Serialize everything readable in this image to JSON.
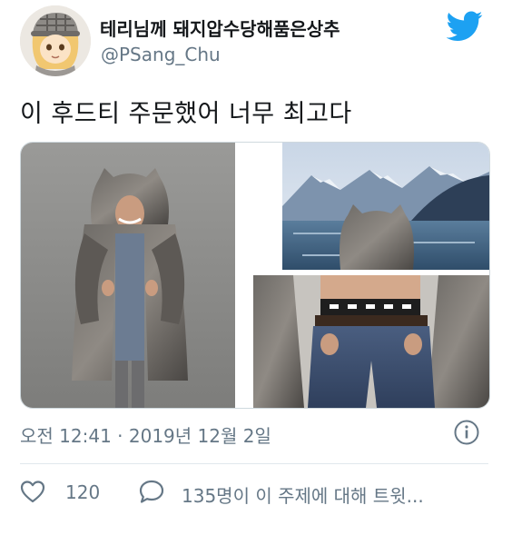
{
  "tweet": {
    "display_name": "테리님께 돼지압수당해품은상추",
    "handle": "@PSang_Chu",
    "text": "이 후드티 주문했어 너무 최고다",
    "timestamp": "오전 12:41 · 2019년 12월 2일",
    "like_count": "120",
    "reply_text": "135명이 이 주제에 대해 트윗..."
  },
  "media": {
    "images": [
      {
        "name": "wolf-fur-coat-photo"
      },
      {
        "name": "mountain-lake-wolf-hood-photo"
      },
      {
        "name": "fur-coat-jeans-photo"
      }
    ]
  },
  "colors": {
    "brand_blue": "#1da1f2",
    "text_primary": "#14171a",
    "text_secondary": "#657786",
    "border": "#cfd9de"
  },
  "icons": [
    "avatar-icon",
    "twitter-bird-icon",
    "info-icon",
    "heart-icon",
    "reply-bubble-icon"
  ]
}
